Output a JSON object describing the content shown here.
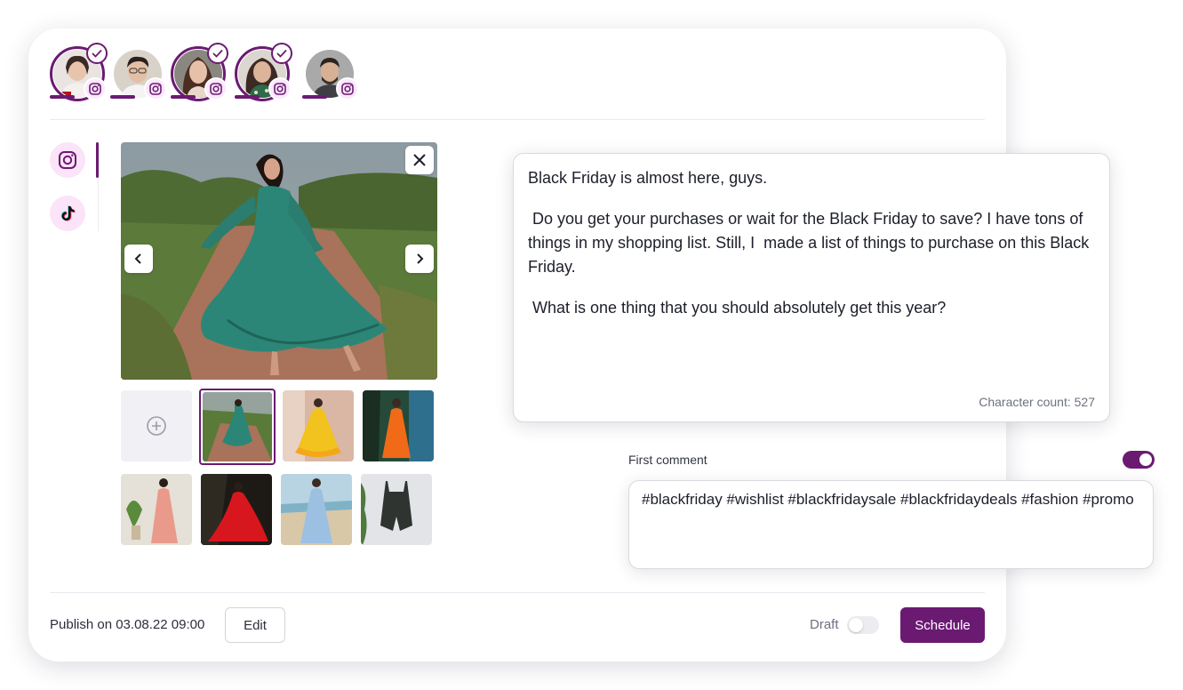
{
  "accounts": [
    {
      "name": "account-1",
      "selected": true,
      "network": "instagram-icon"
    },
    {
      "name": "account-2",
      "selected": false,
      "network": "instagram-icon"
    },
    {
      "name": "account-3",
      "selected": true,
      "network": "instagram-icon"
    },
    {
      "name": "account-4",
      "selected": true,
      "network": "instagram-icon"
    },
    {
      "name": "account-5",
      "selected": false,
      "network": "instagram-icon"
    }
  ],
  "networks": [
    {
      "icon": "instagram-icon",
      "active": true
    },
    {
      "icon": "tiktok-icon",
      "active": false
    }
  ],
  "media": {
    "thumbnails": [
      "add",
      "green-dress",
      "yellow-dress",
      "orange-dress",
      "pink-dress",
      "red-dress",
      "blue-dress",
      "black-romper"
    ],
    "selected_index": 1
  },
  "caption": {
    "line1": "Black Friday is almost here, guys.",
    "line2": " Do you get your purchases or wait for the Black Friday to save? I have tons of things in my shopping list. Still, I  made a list of things to purchase on this Black Friday.",
    "line3": " What is one thing that you should absolutely get this year?",
    "char_count": "Character count: 527"
  },
  "first_comment": {
    "label": "First comment",
    "enabled": true,
    "text": "#blackfriday #wishlist #blackfridaysale #blackfridaydeals #fashion #promo"
  },
  "footer": {
    "publish_text": "Publish on 03.08.22 09:00",
    "edit_label": "Edit",
    "draft_label": "Draft",
    "draft_enabled": false,
    "schedule_label": "Schedule"
  },
  "colors": {
    "accent": "#6b1a72",
    "accent_light": "#fbe3f8"
  }
}
